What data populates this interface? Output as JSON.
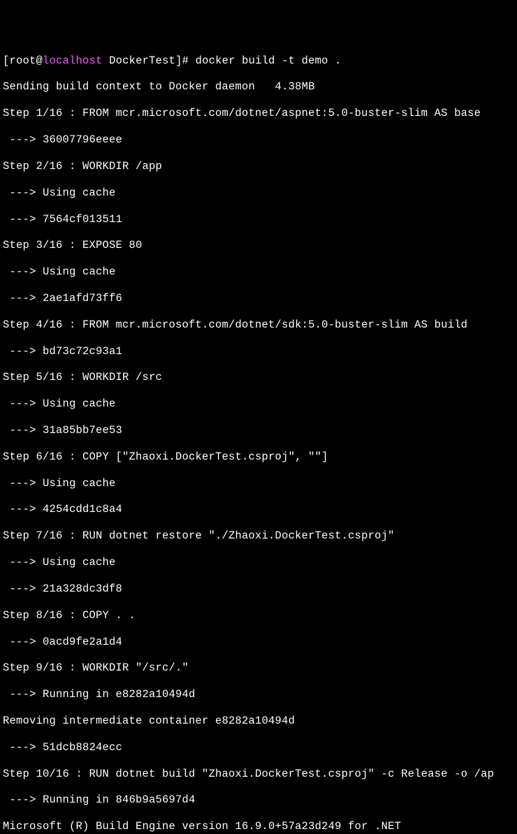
{
  "prompt": {
    "user": "root",
    "at": "@",
    "host": "localhost",
    "space_path": " DockerTest",
    "bracket_close": "]# ",
    "cmd": "docker build -t demo ."
  },
  "lines": {
    "l01": "Sending build context to Docker daemon   4.38MB",
    "l02": "Step 1/16 : FROM mcr.microsoft.com/dotnet/aspnet:5.0-buster-slim AS base",
    "l03": " ---> 36007796eeee",
    "l04": "Step 2/16 : WORKDIR /app",
    "l05": " ---> Using cache",
    "l06": " ---> 7564cf013511",
    "l07": "Step 3/16 : EXPOSE 80",
    "l08": " ---> Using cache",
    "l09": " ---> 2ae1afd73ff6",
    "l10": "Step 4/16 : FROM mcr.microsoft.com/dotnet/sdk:5.0-buster-slim AS build",
    "l11": " ---> bd73c72c93a1",
    "l12": "Step 5/16 : WORKDIR /src",
    "l13": " ---> Using cache",
    "l14": " ---> 31a85bb7ee53",
    "l15": "Step 6/16 : COPY [\"Zhaoxi.DockerTest.csproj\", \"\"]",
    "l16": " ---> Using cache",
    "l17": " ---> 4254cdd1c8a4",
    "l18": "Step 7/16 : RUN dotnet restore \"./Zhaoxi.DockerTest.csproj\"",
    "l19": " ---> Using cache",
    "l20": " ---> 21a328dc3df8",
    "l21": "Step 8/16 : COPY . .",
    "l22": " ---> 0acd9fe2a1d4",
    "l23": "Step 9/16 : WORKDIR \"/src/.\"",
    "l24": " ---> Running in e8282a10494d",
    "l25": "Removing intermediate container e8282a10494d",
    "l26": " ---> 51dcb8824ecc",
    "l27": "Step 10/16 : RUN dotnet build \"Zhaoxi.DockerTest.csproj\" -c Release -o /ap",
    "l28": " ---> Running in 846b9a5697d4",
    "l29": "Microsoft (R) Build Engine version 16.9.0+57a23d249 for .NET"
  }
}
